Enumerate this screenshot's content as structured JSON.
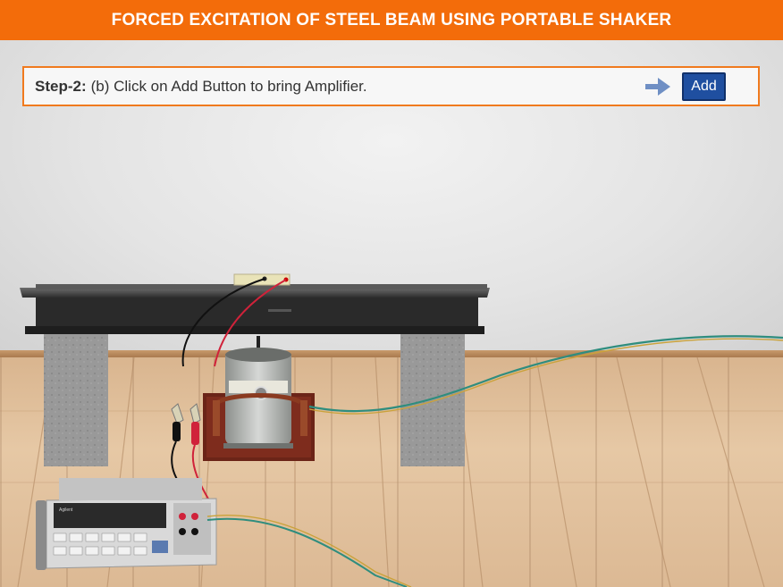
{
  "header": {
    "title": "FORCED EXCITATION OF STEEL BEAM USING PORTABLE SHAKER"
  },
  "instruction": {
    "step_label": "Step-2:",
    "text": "(b) Click on Add Button to bring Amplifier.",
    "arrow_icon": "right-arrow-icon",
    "add_label": "Add"
  },
  "equipment": {
    "multimeter_brand": "Agilent",
    "shaker_icon": "vibration-shaker",
    "clips_icon": "alligator-clips"
  },
  "colors": {
    "header_bg": "#f36c0a",
    "instruction_border": "#f07a1e",
    "add_button_bg": "#1f4fa0",
    "arrow": "#6f8fc4"
  }
}
